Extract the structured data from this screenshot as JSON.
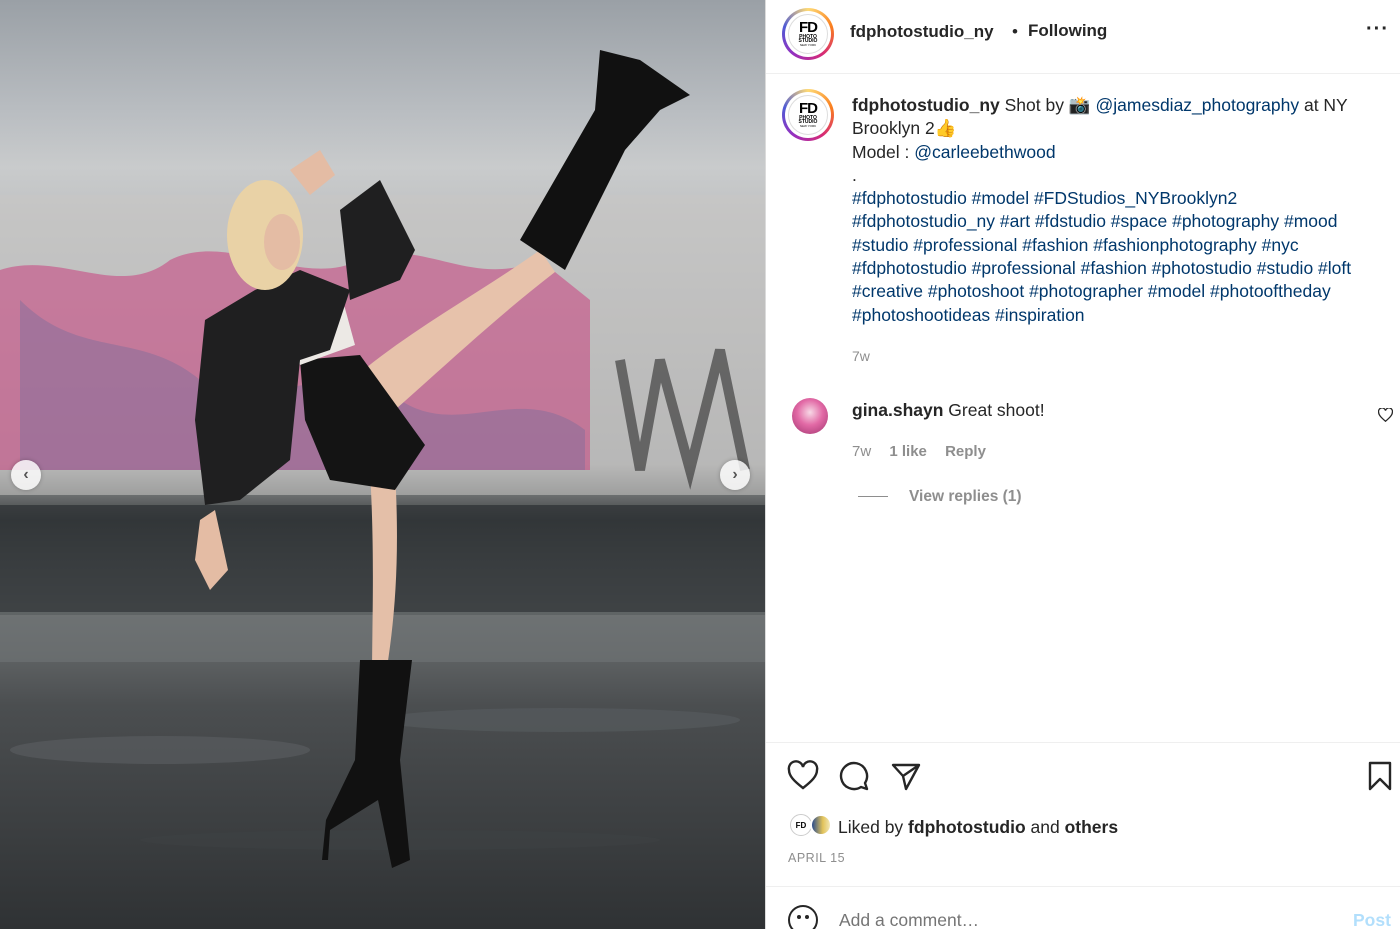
{
  "post": {
    "username": "fdphotostudio_ny",
    "follow_dot": "•",
    "follow_status": "Following",
    "more_icon": "···"
  },
  "logo": {
    "fd": "FD",
    "line1": "PHOTO",
    "line2": "STUDIO",
    "line3": "NEW YORK"
  },
  "caption": {
    "username": "fdphotostudio_ny",
    "text1": " Shot by 📸 ",
    "mention1": "@jamesdiaz_photography",
    "text2": " at NY Brooklyn 2👍",
    "model_label": "Model : ",
    "mention2": "@carleebethwood",
    "dot": ".",
    "hashtags": "#fdphotostudio #model #FDStudios_NYBrooklyn2 #fdphotostudio_ny #art #fdstudio #space #photography #mood #studio #professional #fashion #fashionphotography #nyc #fdphotostudio #professional #fashion #photostudio #studio #loft #creative #photoshoot #photographer #model #photooftheday #photoshootideas #inspiration",
    "time": "7w"
  },
  "comment": {
    "username": "gina.shayn",
    "text": " Great shoot!",
    "time": "7w",
    "likes": "1 like",
    "reply": "Reply",
    "view_replies": "View replies (1)"
  },
  "likes": {
    "prefix": "Liked by ",
    "user": "fdphotostudio",
    "middle": " and ",
    "others": "others"
  },
  "date": "APRIL 15",
  "comment_box": {
    "placeholder": "Add a comment…",
    "post_label": "Post"
  },
  "nav": {
    "prev": "‹",
    "next": "›"
  },
  "colors": {
    "link": "#00376b",
    "muted": "#8e8e8e",
    "post_disabled": "#b2dffc"
  }
}
